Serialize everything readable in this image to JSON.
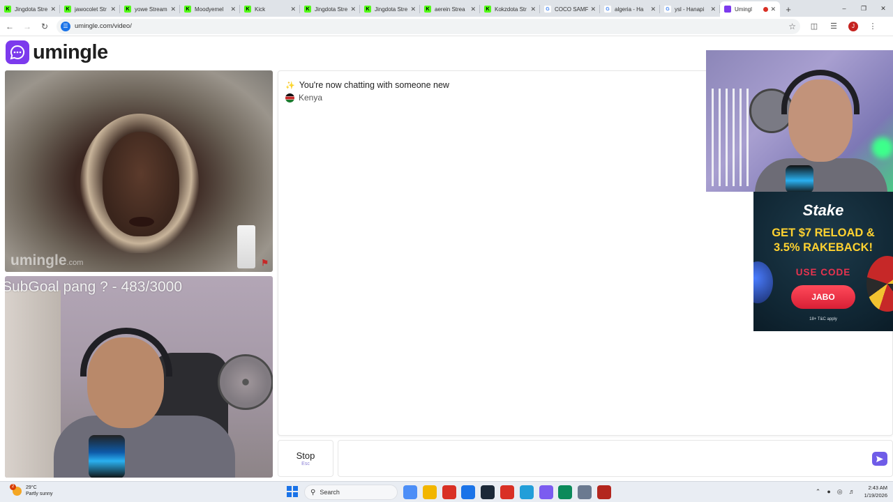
{
  "browser": {
    "tabs": [
      {
        "title": "Jingdota Stre",
        "favicon": "kick-icon",
        "color": "#53fc18",
        "active": false
      },
      {
        "title": "jawocolet Str",
        "favicon": "kick-icon",
        "color": "#53fc18",
        "active": false
      },
      {
        "title": "yowe Stream",
        "favicon": "kick-icon",
        "color": "#53fc18",
        "active": false
      },
      {
        "title": "Moodyemel",
        "favicon": "kick-icon",
        "color": "#53fc18",
        "active": false
      },
      {
        "title": "Kick",
        "favicon": "kick-icon",
        "color": "#53fc18",
        "active": false
      },
      {
        "title": "Jingdota Stre",
        "favicon": "kick-icon",
        "color": "#53fc18",
        "active": false
      },
      {
        "title": "Jingdota Stre",
        "favicon": "kick-icon",
        "color": "#53fc18",
        "active": false
      },
      {
        "title": "aerein Strea",
        "favicon": "kick-icon",
        "color": "#53fc18",
        "active": false
      },
      {
        "title": "Kokzdota Str",
        "favicon": "kick-icon",
        "color": "#53fc18",
        "active": false
      },
      {
        "title": "COCO SAMF",
        "favicon": "google-icon",
        "color": "#ffffff",
        "active": false
      },
      {
        "title": "algeria - Ha",
        "favicon": "google-icon",
        "color": "#ffffff",
        "active": false
      },
      {
        "title": "ysl - Hanapi",
        "favicon": "google-icon",
        "color": "#ffffff",
        "active": false
      },
      {
        "title": "Umingl",
        "favicon": "umingle-icon",
        "color": "#7c3aed",
        "active": true
      }
    ],
    "url": "umingle.com/video/",
    "profile_initial": "J"
  },
  "page": {
    "logo_text": "umingle",
    "brand_color": "#7c3aed",
    "stranger_video": {
      "watermark": "umingle",
      "watermark_suffix": ".com"
    },
    "streamer_video": {
      "overlay_text": "SubGoal pang ? - 483/3000"
    },
    "chat": {
      "new_chat_message": "You're now chatting with someone new",
      "country": "Kenya"
    },
    "controls": {
      "stop_label": "Stop",
      "stop_shortcut": "Esc",
      "message_value": "",
      "accent_color": "#6f5ce8"
    }
  },
  "ad": {
    "brand": "Stake",
    "headline_line1": "GET $7 RELOAD &",
    "headline_line2": "3.5% RAKEBACK!",
    "use_code_label": "USE CODE",
    "code": "JABO",
    "terms": "18+ T&C apply"
  },
  "taskbar": {
    "weather_temp": "29°C",
    "weather_desc": "Partly sunny",
    "weather_badge": "2",
    "search_label": "Search",
    "time": "2:43 AM",
    "date": "1/19/2026",
    "pinned_colors": [
      "#4c8ef7",
      "#f2b600",
      "#d93025",
      "#1a73e8",
      "#1b2838",
      "#d93025",
      "#229ed9",
      "#7b5cf0",
      "#0b8a5a",
      "#6b7a90",
      "#b3261e"
    ]
  }
}
